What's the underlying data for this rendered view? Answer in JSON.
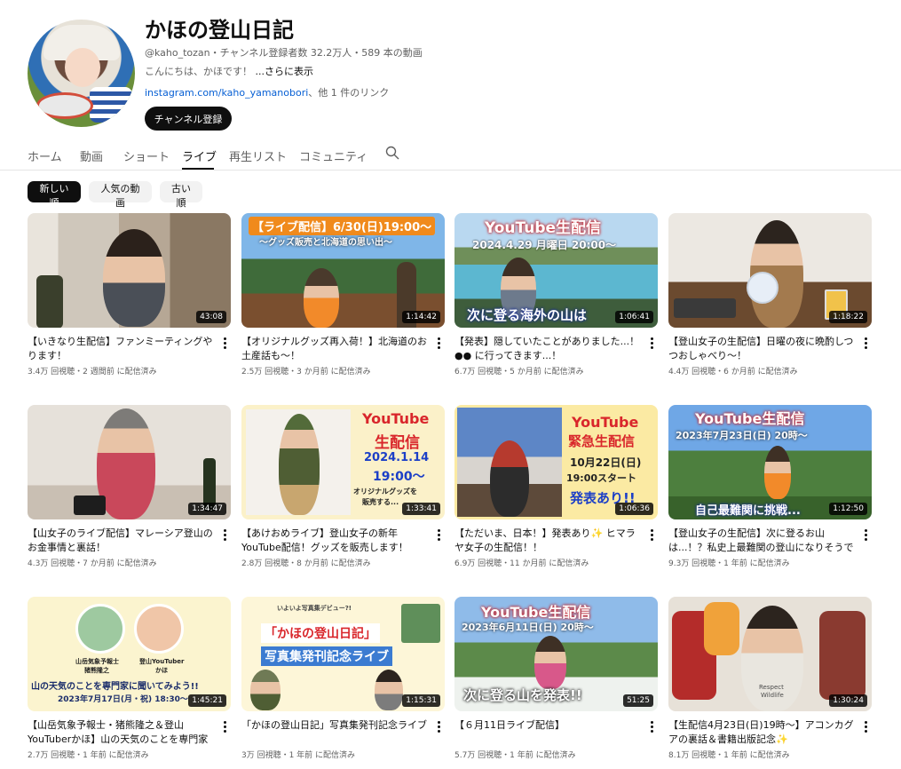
{
  "channel": {
    "name": "かほの登山日記",
    "meta": "@kaho_tozan・チャンネル登録者数 32.2万人・589 本の動画",
    "description": "こんにちは、かほです！",
    "more": "...さらに表示",
    "link": "instagram.com/kaho_yamanobori",
    "link_suffix": "、他 1 件のリンク",
    "subscribe_label": "チャンネル登録"
  },
  "tabs": [
    {
      "label": "ホーム"
    },
    {
      "label": "動画"
    },
    {
      "label": "ショート"
    },
    {
      "label": "ライブ"
    },
    {
      "label": "再生リスト"
    },
    {
      "label": "コミュニティ"
    }
  ],
  "active_tab": "ライブ",
  "chips": [
    {
      "label": "新しい順"
    },
    {
      "label": "人気の動画"
    },
    {
      "label": "古い順"
    }
  ],
  "videos": [
    {
      "title": "【いきなり生配信】ファンミーティングやります！",
      "meta": "3.4万 回視聴・2 週間前 に配信済み",
      "duration": "43:08"
    },
    {
      "title": "【オリジナルグッズ再入荷！】北海道のお土産話も〜！",
      "meta": "2.5万 回視聴・3 か月前 に配信済み",
      "duration": "1:14:42",
      "overlay1": "【ライブ配信】6/30(日)19:00〜",
      "overlay2": "〜グッズ販売と北海道の思い出〜"
    },
    {
      "title": "【発表】隠していたことがありました...！●● に行ってきます...！",
      "meta": "6.7万 回視聴・5 か月前 に配信済み",
      "duration": "1:06:41",
      "overlay1": "YouTube生配信",
      "overlay2": "2024.4.29  月曜日  20:00〜",
      "overlay3": "次に登る海外の山は"
    },
    {
      "title": "【登山女子の生配信】日曜の夜に晩酌しつつおしゃべり〜！",
      "meta": "4.4万 回視聴・6 か月前 に配信済み",
      "duration": "1:18:22"
    },
    {
      "title": "【山女子のライブ配信】マレーシア登山のお金事情と裏話！",
      "meta": "4.3万 回視聴・7 か月前 に配信済み",
      "duration": "1:34:47"
    },
    {
      "title": "【あけおめライブ】登山女子の新年YouTube配信！グッズを販売します！",
      "meta": "2.8万 回視聴・8 か月前 に配信済み",
      "duration": "1:33:41",
      "overlay1": "YouTube",
      "overlay2": "生配信",
      "overlay3": "2024.1.14",
      "overlay4": "19:00〜",
      "overlay5": "オリジナルグッズを",
      "overlay6": "販売する..."
    },
    {
      "title": "【ただいま、日本！】発表あり✨ ヒマラヤ女子の生配信！！",
      "meta": "6.9万 回視聴・11 か月前 に配信済み",
      "duration": "1:06:36",
      "overlay1": "YouTube",
      "overlay2": "緊急生配信",
      "overlay3": "10月22日(日)",
      "overlay4": "19:00スタート",
      "overlay5": "発表あり!!"
    },
    {
      "title": "【登山女子の生配信】次に登るお山は...！？私史上最難関の登山になりそうです...！！",
      "meta": "9.3万 回視聴・1 年前 に配信済み",
      "duration": "1:12:50",
      "overlay1": "YouTube生配信",
      "overlay2": "2023年7月23日(日) 20時〜",
      "overlay3": "自己最難関に挑戦..."
    },
    {
      "title": "【山岳気象予報士・猪熊隆之＆登山YouTuberかほ】山の天気のことを専門家に...",
      "meta": "2.7万 回視聴・1 年前 に配信済み",
      "duration": "1:45:21",
      "overlay1": "山岳気象予報士",
      "overlay2": "猪熊隆之",
      "overlay3": "登山YouTuber",
      "overlay4": "かほ",
      "overlay5": "山の天気のことを専門家に聞いてみよう!!",
      "overlay6": "2023年7月17日(月・祝) 18:30〜"
    },
    {
      "title": "「かほの登山日記」写真集発刊記念ライブ",
      "meta": "3万 回視聴・1 年前 に配信済み",
      "duration": "1:15:31",
      "overlay1": "いよいよ写真集デビュー?!",
      "overlay2": "「かほの登山日記」",
      "overlay3": "写真集発刊記念ライブ"
    },
    {
      "title": "【６月11日ライブ配信】",
      "meta": "5.7万 回視聴・1 年前 に配信済み",
      "duration": "51:25",
      "overlay1": "YouTube生配信",
      "overlay2": "2023年6月11日(日) 20時〜",
      "overlay3": "次に登る山を発表!!"
    },
    {
      "title": "【生配信4月23日(日)19時〜】アコンカグアの裏話＆書籍出版記念✨",
      "meta": "8.1万 回視聴・1 年前 に配信済み",
      "duration": "1:30:24",
      "overlay1": "Respect",
      "overlay2": "Wildlife"
    }
  ]
}
